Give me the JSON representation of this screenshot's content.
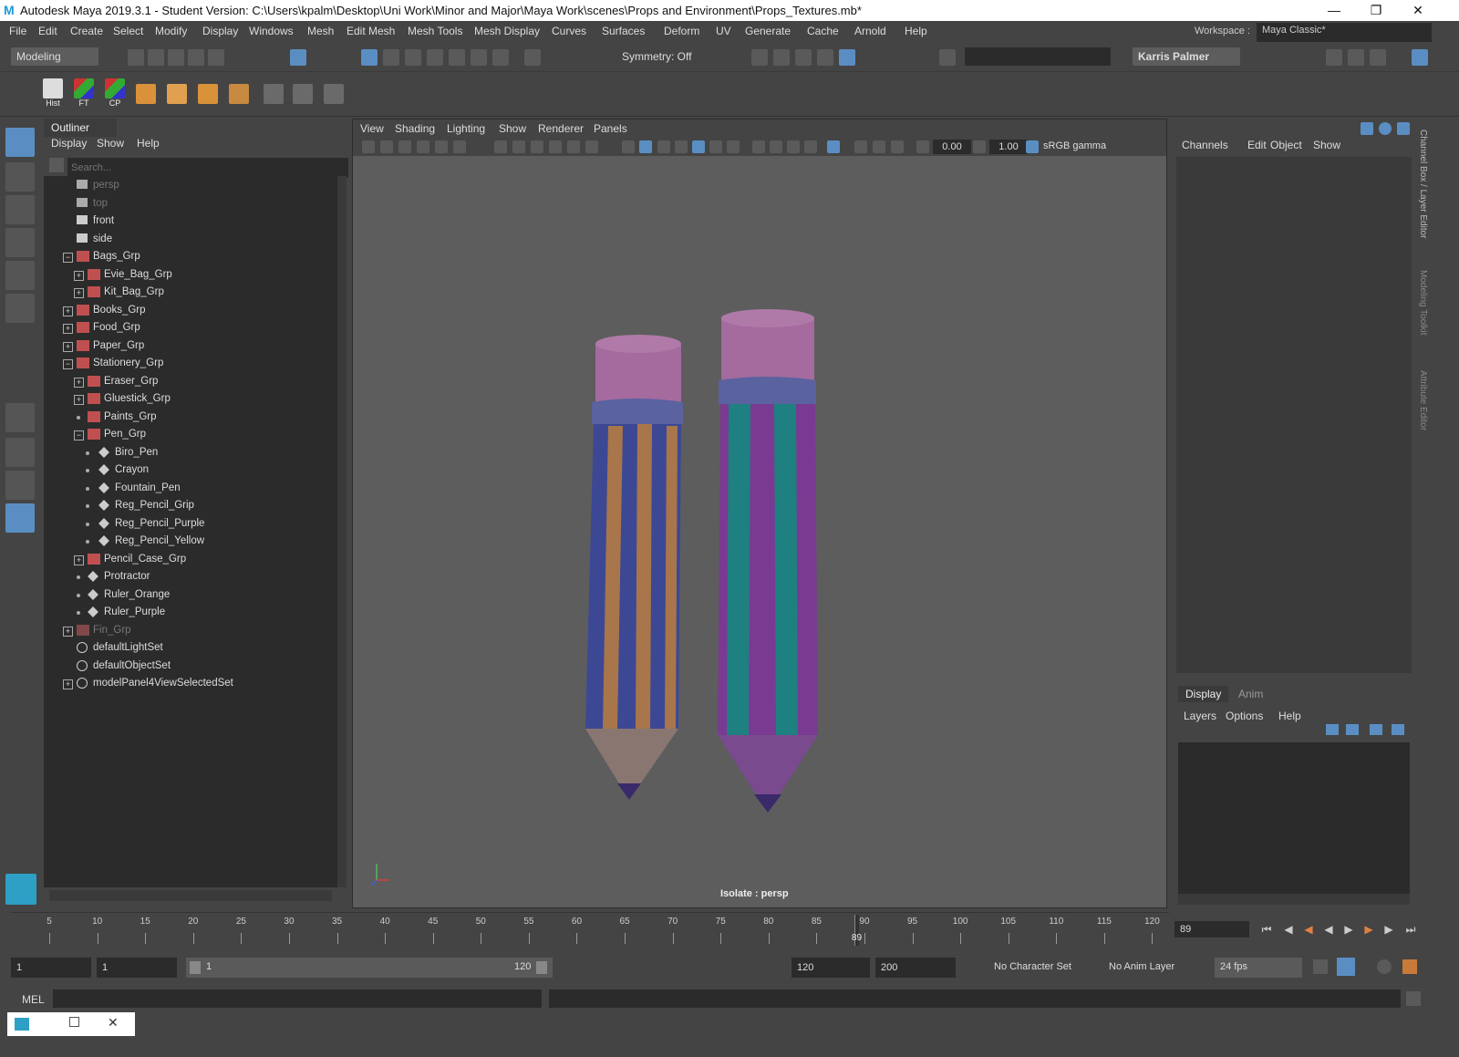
{
  "titlebar": {
    "title": "Autodesk Maya 2019.3.1 - Student Version: C:\\Users\\kpalm\\Desktop\\Uni Work\\Minor and Major\\Maya Work\\scenes\\Props and Environment\\Props_Textures.mb*",
    "logo": "M"
  },
  "menus": [
    "File",
    "Edit",
    "Create",
    "Select",
    "Modify",
    "Display",
    "Windows",
    "Mesh",
    "Edit Mesh",
    "Mesh Tools",
    "Mesh Display",
    "Curves",
    "Surfaces",
    "Deform",
    "UV",
    "Generate",
    "Cache",
    "Arnold",
    "Help"
  ],
  "workspace": {
    "label": "Workspace :",
    "value": "Maya Classic*"
  },
  "statusline": {
    "mode": "Modeling",
    "symmetry": "Symmetry: Off",
    "user": "Karris Palmer"
  },
  "shelf": {
    "hist": "Hist",
    "ft": "FT",
    "cp": "CP"
  },
  "outliner": {
    "tab": "Outliner",
    "menus": [
      "Display",
      "Show",
      "Help"
    ],
    "search_placeholder": "Search...",
    "nodes": [
      "persp",
      "top",
      "front",
      "side",
      "Bags_Grp",
      "Evie_Bag_Grp",
      "Kit_Bag_Grp",
      "Books_Grp",
      "Food_Grp",
      "Paper_Grp",
      "Stationery_Grp",
      "Eraser_Grp",
      "Gluestick_Grp",
      "Paints_Grp",
      "Pen_Grp",
      "Biro_Pen",
      "Crayon",
      "Fountain_Pen",
      "Reg_Pencil_Grip",
      "Reg_Pencil_Purple",
      "Reg_Pencil_Yellow",
      "Pencil_Case_Grp",
      "Protractor",
      "Ruler_Orange",
      "Ruler_Purple",
      "Fin_Grp",
      "defaultLightSet",
      "defaultObjectSet",
      "modelPanel4ViewSelectedSet"
    ]
  },
  "viewport": {
    "menus": [
      "View",
      "Shading",
      "Lighting",
      "Show",
      "Renderer",
      "Panels"
    ],
    "exposure": "0.00",
    "gamma_value": "1.00",
    "colorspace": "sRGB gamma",
    "isolate": "Isolate : persp"
  },
  "channelbox": {
    "menus": [
      "Channels",
      "Edit",
      "Object",
      "Show"
    ],
    "layer_tabs": [
      "Display",
      "Anim"
    ],
    "layer_menus": [
      "Layers",
      "Options",
      "Help"
    ]
  },
  "sidetabs": [
    "Channel Box / Layer Editor",
    "Modeling Toolkit",
    "Attribute Editor"
  ],
  "timeline": {
    "ticks": [
      "5",
      "10",
      "15",
      "20",
      "25",
      "30",
      "35",
      "40",
      "45",
      "50",
      "55",
      "60",
      "65",
      "70",
      "75",
      "80",
      "85",
      "90",
      "95",
      "100",
      "105",
      "110",
      "115",
      "120"
    ],
    "current": "89",
    "current_field": "89"
  },
  "range": {
    "start": "1",
    "start2": "1",
    "slider_start": "1",
    "slider_end": "120",
    "end": "120",
    "end2": "200",
    "charset": "No Character Set",
    "animlayer": "No Anim Layer",
    "fps": "24 fps"
  },
  "cmdline": {
    "label": "MEL"
  },
  "colors": {
    "accent": "#5a8ec2",
    "pencil_cap": "#a56a9e",
    "pencil_band": "#5a62a0",
    "stripe_orange": "#a8764a",
    "stripe_blue": "#3d4894",
    "stripe_teal": "#1e8080",
    "stripe_purple": "#7a3a92",
    "tip": "#3a2a6a"
  }
}
